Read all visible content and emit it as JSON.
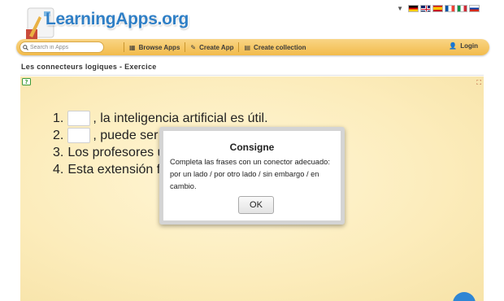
{
  "header": {
    "logo_text": "LearningApps.org",
    "language_flags": [
      "de-flag-icon",
      "gb-flag-icon",
      "es-flag-icon",
      "fr-flag-icon",
      "it-flag-icon",
      "ru-flag-icon"
    ]
  },
  "toolbar": {
    "search_placeholder": "Search in Apps",
    "browse_label": "Browse Apps",
    "create_label": "Create App",
    "collection_label": "Create collection",
    "login_label": "Login"
  },
  "page": {
    "title": "Les connecteurs logiques - Exercice"
  },
  "exercise": {
    "lines": [
      {
        "num": "1.",
        "text": ", la inteligencia artificial es útil."
      },
      {
        "num": "2.",
        "text": ", puede ser peligros"
      },
      {
        "num": "3.",
        "text": "Los profesores usan IA."
      },
      {
        "num": "4.",
        "text": "Esta extensión funciona bi"
      }
    ]
  },
  "modal": {
    "title": "Consigne",
    "text": "Completa las frases con un conector adecuado: por un lado / por otro lado / sin embargo / en cambio.",
    "ok_label": "OK"
  },
  "colors": {
    "toolbar": "#f2bb4b",
    "logo_blue": "#2f7fc6",
    "exercise_bg": "#fcecbb",
    "fab": "#2f86d4"
  }
}
